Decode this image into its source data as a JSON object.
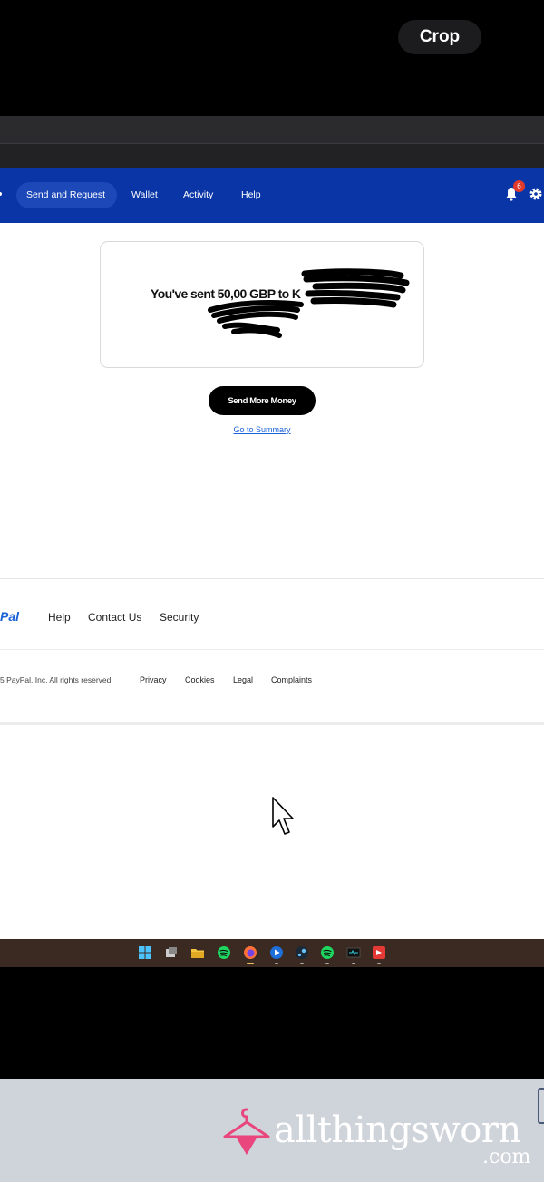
{
  "overlay": {
    "crop_label": "Crop"
  },
  "nav": {
    "items": [
      "Send and Request",
      "Wallet",
      "Activity",
      "Help"
    ],
    "notification_count": "6",
    "brand_color": "#0a35a6"
  },
  "confirmation": {
    "message": "You've sent 50,00 GBP to K",
    "send_more_label": "Send More Money",
    "summary_link_label": "Go to Summary"
  },
  "footer": {
    "logo_text": "Pal",
    "links": [
      "Help",
      "Contact Us",
      "Security"
    ],
    "copyright": "5 PayPal, Inc. All rights reserved.",
    "legal_links": [
      "Privacy",
      "Cookies",
      "Legal",
      "Complaints"
    ]
  },
  "taskbar": {
    "icons": [
      "windows-start-icon",
      "task-view-icon",
      "file-explorer-icon",
      "spotify-icon",
      "firefox-icon",
      "launcher-icon",
      "steam-icon",
      "spotify-icon",
      "terminal-icon",
      "app-icon"
    ]
  },
  "watermark": {
    "name": "allthingsworn",
    "suffix": ".com"
  }
}
